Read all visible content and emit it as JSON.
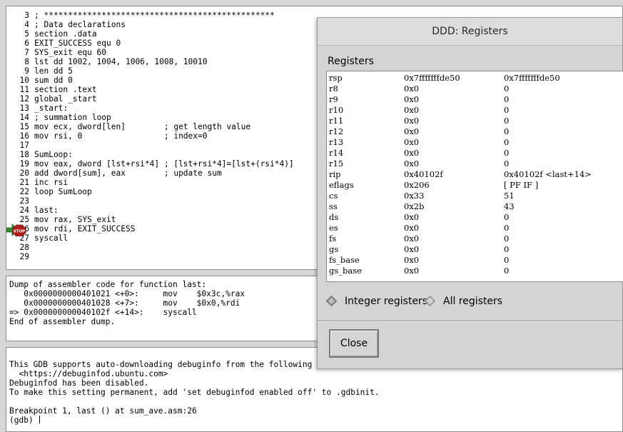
{
  "source": {
    "lines": [
      {
        "num": "3",
        "text": "; ************************************************"
      },
      {
        "num": "4",
        "text": "; Data declarations"
      },
      {
        "num": "5",
        "text": "section .data"
      },
      {
        "num": "6",
        "text": "EXIT_SUCCESS equ 0"
      },
      {
        "num": "7",
        "text": "SYS_exit equ 60"
      },
      {
        "num": "8",
        "text": "lst dd 1002, 1004, 1006, 1008, 10010"
      },
      {
        "num": "9",
        "text": "len dd 5"
      },
      {
        "num": "10",
        "text": "sum dd 0"
      },
      {
        "num": "11",
        "text": "section .text"
      },
      {
        "num": "12",
        "text": "global _start"
      },
      {
        "num": "13",
        "text": "_start:"
      },
      {
        "num": "14",
        "text": "; summation loop"
      },
      {
        "num": "15",
        "text": "mov ecx, dword[len]        ; get length value"
      },
      {
        "num": "16",
        "text": "mov rsi, 0                 ; index=0"
      },
      {
        "num": "17",
        "text": ""
      },
      {
        "num": "18",
        "text": "SumLoop:"
      },
      {
        "num": "19",
        "text": "mov eax, dword [lst+rsi*4] ; [lst+rsi*4]=[lst+(rsi*4)]"
      },
      {
        "num": "20",
        "text": "add dword[sum], eax        ; update sum"
      },
      {
        "num": "21",
        "text": "inc rsi"
      },
      {
        "num": "22",
        "text": "loop SumLoop"
      },
      {
        "num": "23",
        "text": ""
      },
      {
        "num": "24",
        "text": "last:"
      },
      {
        "num": "25",
        "text": "mov rax, SYS_exit"
      },
      {
        "num": "26",
        "text": "mov rdi, EXIT_SUCCESS"
      },
      {
        "num": "27",
        "text": "syscall"
      },
      {
        "num": "28",
        "text": ""
      },
      {
        "num": "29",
        "text": ""
      }
    ],
    "breakpoint_label": "STOP",
    "breakpoint_line": "26"
  },
  "machine_code": {
    "lines": [
      "Dump of assembler code for function last:",
      "   0x0000000000401021 <+0>:     mov    $0x3c,%rax",
      "   0x0000000000401028 <+7>:     mov    $0x0,%rdi",
      "=> 0x000000000040102f <+14>:    syscall",
      "End of assembler dump."
    ]
  },
  "console": {
    "lines": [
      "This GDB supports auto-downloading debuginfo from the following URLs:",
      "  <https://debuginfod.ubuntu.com>",
      "Debuginfod has been disabled.",
      "To make this setting permanent, add 'set debuginfod enabled off' to .gdbinit.",
      "",
      "Breakpoint 1, last () at sum_ave.asm:26",
      "(gdb) "
    ]
  },
  "dialog": {
    "title": "DDD: Registers",
    "section_label": "Registers",
    "registers": [
      {
        "name": "rsp",
        "raw": "0x7fffffffde50",
        "natural": "0x7fffffffde50"
      },
      {
        "name": "r8",
        "raw": "0x0",
        "natural": "0"
      },
      {
        "name": "r9",
        "raw": "0x0",
        "natural": "0"
      },
      {
        "name": "r10",
        "raw": "0x0",
        "natural": "0"
      },
      {
        "name": "r11",
        "raw": "0x0",
        "natural": "0"
      },
      {
        "name": "r12",
        "raw": "0x0",
        "natural": "0"
      },
      {
        "name": "r13",
        "raw": "0x0",
        "natural": "0"
      },
      {
        "name": "r14",
        "raw": "0x0",
        "natural": "0"
      },
      {
        "name": "r15",
        "raw": "0x0",
        "natural": "0"
      },
      {
        "name": "rip",
        "raw": "0x40102f",
        "natural": "0x40102f <last+14>"
      },
      {
        "name": "eflags",
        "raw": "0x206",
        "natural": "[ PF IF ]"
      },
      {
        "name": "cs",
        "raw": "0x33",
        "natural": "51"
      },
      {
        "name": "ss",
        "raw": "0x2b",
        "natural": "43"
      },
      {
        "name": "ds",
        "raw": "0x0",
        "natural": "0"
      },
      {
        "name": "es",
        "raw": "0x0",
        "natural": "0"
      },
      {
        "name": "fs",
        "raw": "0x0",
        "natural": "0"
      },
      {
        "name": "gs",
        "raw": "0x0",
        "natural": "0"
      },
      {
        "name": "fs_base",
        "raw": "0x0",
        "natural": "0"
      },
      {
        "name": "gs_base",
        "raw": "0x0",
        "natural": "0"
      }
    ],
    "radio_integer": "Integer registers",
    "radio_all": "All registers",
    "selected_view": "Integer registers",
    "close_label": "Close"
  },
  "colors": {
    "breakpoint_stop": "#b01c1c",
    "execution_arrow": "#2e8b2e"
  }
}
